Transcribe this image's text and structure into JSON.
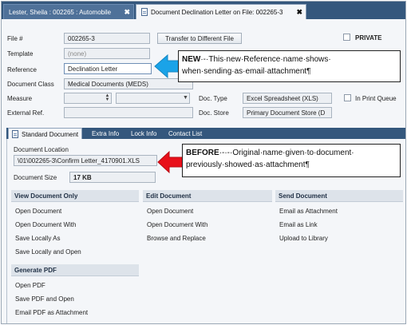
{
  "tabs": [
    {
      "label": "Lester, Sheila : 002265 : Automobile",
      "close": "✖"
    },
    {
      "label": "Document Declination Letter on File: 002265-3",
      "close": "✖"
    }
  ],
  "form": {
    "file_label": "File #",
    "file_value": "002265-3",
    "transfer_button": "Transfer to Different File",
    "private_label": "PRIVATE",
    "template_label": "Template",
    "template_value": "(none)",
    "reference_label": "Reference",
    "reference_value": "Declination Letter",
    "doc_class_label": "Document Class",
    "doc_class_value": "Medical Documents (MEDS)",
    "measure_label": "Measure",
    "doc_type_label": "Doc. Type",
    "doc_type_value": "Excel Spreadsheet (XLS)",
    "in_print_queue_label": "In Print Queue",
    "external_ref_label": "External Ref.",
    "doc_store_label": "Doc. Store",
    "doc_store_value": "Primary Document Store (D"
  },
  "panel_tabs": [
    "Standard Document",
    "Extra Info",
    "Lock Info",
    "Contact List"
  ],
  "document": {
    "location_label": "Document Location",
    "location_value": "\\01\\002265-3\\Confirm Letter_4170901.XLS",
    "size_label": "Document Size",
    "size_value": "17 KB"
  },
  "sections": {
    "view": {
      "title": "View Document Only",
      "items": [
        "Open Document",
        "Open Document With",
        "Save Locally As",
        "Save Locally and Open"
      ]
    },
    "edit": {
      "title": "Edit Document",
      "items": [
        "Open Document",
        "Open Document With",
        "Browse and Replace"
      ]
    },
    "send": {
      "title": "Send Document",
      "items": [
        "Email as Attachment",
        "Email as Link",
        "Upload to Library"
      ]
    },
    "pdf": {
      "title": "Generate PDF",
      "items": [
        "Open PDF",
        "Save PDF and Open",
        "Email PDF as Attachment"
      ]
    }
  },
  "callouts": {
    "new_bold": "NEW",
    "new_rest": "·-·This·new·Reference·name·shows·",
    "new_line2": "when·sending·as·email·attachment¶",
    "before_bold": "BEFORE",
    "before_rest": "·-·-·Original·name·given·to·document·",
    "before_line2": "previously·showed·as·attachment¶"
  },
  "colors": {
    "tab_strip": "#34577d",
    "blue_arrow": "#1aa3e8",
    "red_arrow": "#e8101a"
  }
}
